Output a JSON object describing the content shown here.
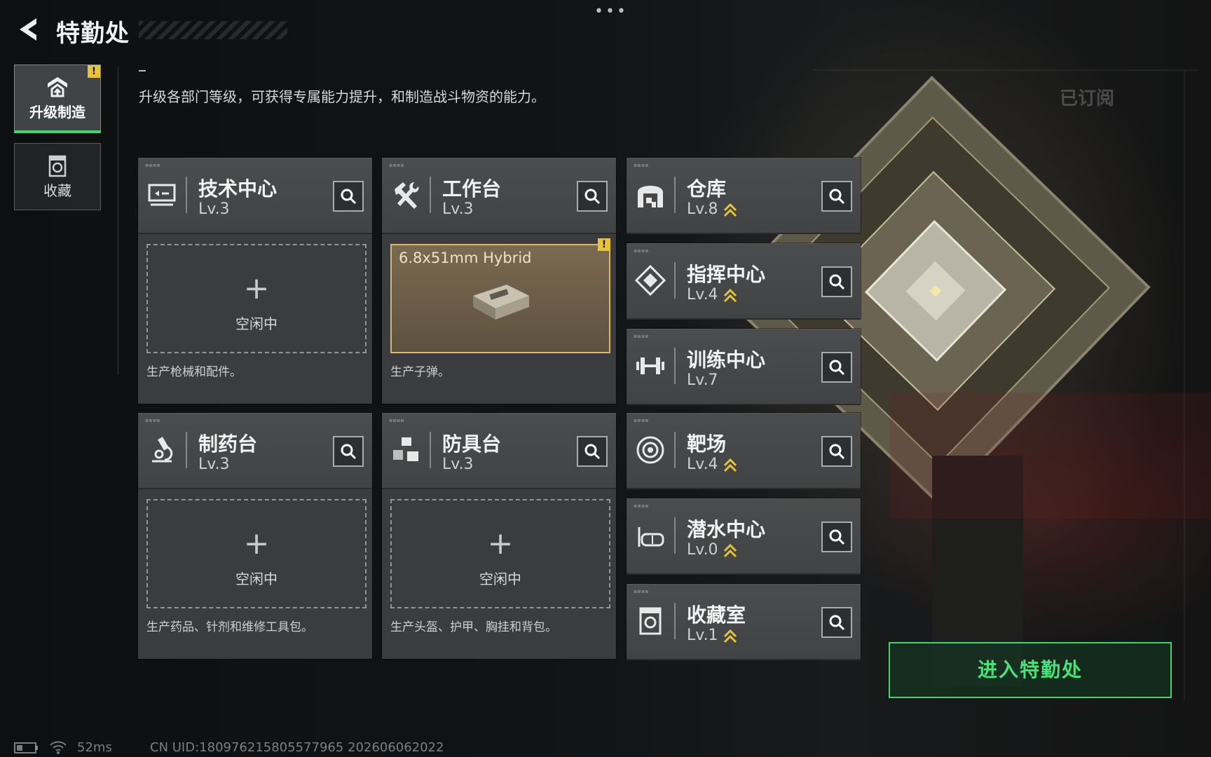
{
  "header": {
    "title": "特勤处",
    "menu_dots": "•••"
  },
  "sidebar": {
    "tabs": [
      {
        "label": "升级制造",
        "icon": "upgrade-icon",
        "active": true,
        "alert": "!"
      },
      {
        "label": "收藏",
        "icon": "collection-icon",
        "active": false
      }
    ]
  },
  "subtitle": "升级各部门等级，可获得专属能力提升，和制造战斗物资的能力。",
  "idle_label": "空闲中",
  "plus_symbol": "+",
  "production": [
    {
      "name": "技术中心",
      "level": "Lv.3",
      "icon": "monitor-icon",
      "slot": "idle",
      "desc": "生产枪械和配件。"
    },
    {
      "name": "工作台",
      "level": "Lv.3",
      "icon": "hammer-wrench-icon",
      "slot": "busy",
      "item": "6.8x51mm Hybrid",
      "alert": "!",
      "desc": "生产子弹。"
    },
    {
      "name": "制药台",
      "level": "Lv.3",
      "icon": "microscope-icon",
      "slot": "idle",
      "desc": "生产药品、针剂和维修工具包。"
    },
    {
      "name": "防具台",
      "level": "Lv.3",
      "icon": "cubes-icon",
      "slot": "idle",
      "desc": "生产头盔、护甲、胸挂和背包。"
    }
  ],
  "departments": [
    {
      "name": "仓库",
      "level": "Lv.8",
      "icon": "warehouse-icon",
      "upgradable": true
    },
    {
      "name": "指挥中心",
      "level": "Lv.4",
      "icon": "command-icon",
      "upgradable": true
    },
    {
      "name": "训练中心",
      "level": "Lv.7",
      "icon": "dumbbell-icon",
      "upgradable": false
    },
    {
      "name": "靶场",
      "level": "Lv.4",
      "icon": "target-icon",
      "upgradable": true
    },
    {
      "name": "潜水中心",
      "level": "Lv.0",
      "icon": "diving-mask-icon",
      "upgradable": true
    },
    {
      "name": "收藏室",
      "level": "Lv.1",
      "icon": "collection-room-icon",
      "upgradable": true
    }
  ],
  "enter_button": "进入特勤处",
  "subscribed_watermark": "已订阅",
  "footer": {
    "ping": "52ms",
    "uid": "CN UID:180976215805577965 202606062022"
  },
  "colors": {
    "accent": "#3fd66f",
    "alert": "#e7c23b",
    "busy_border": "#d8b86a"
  }
}
